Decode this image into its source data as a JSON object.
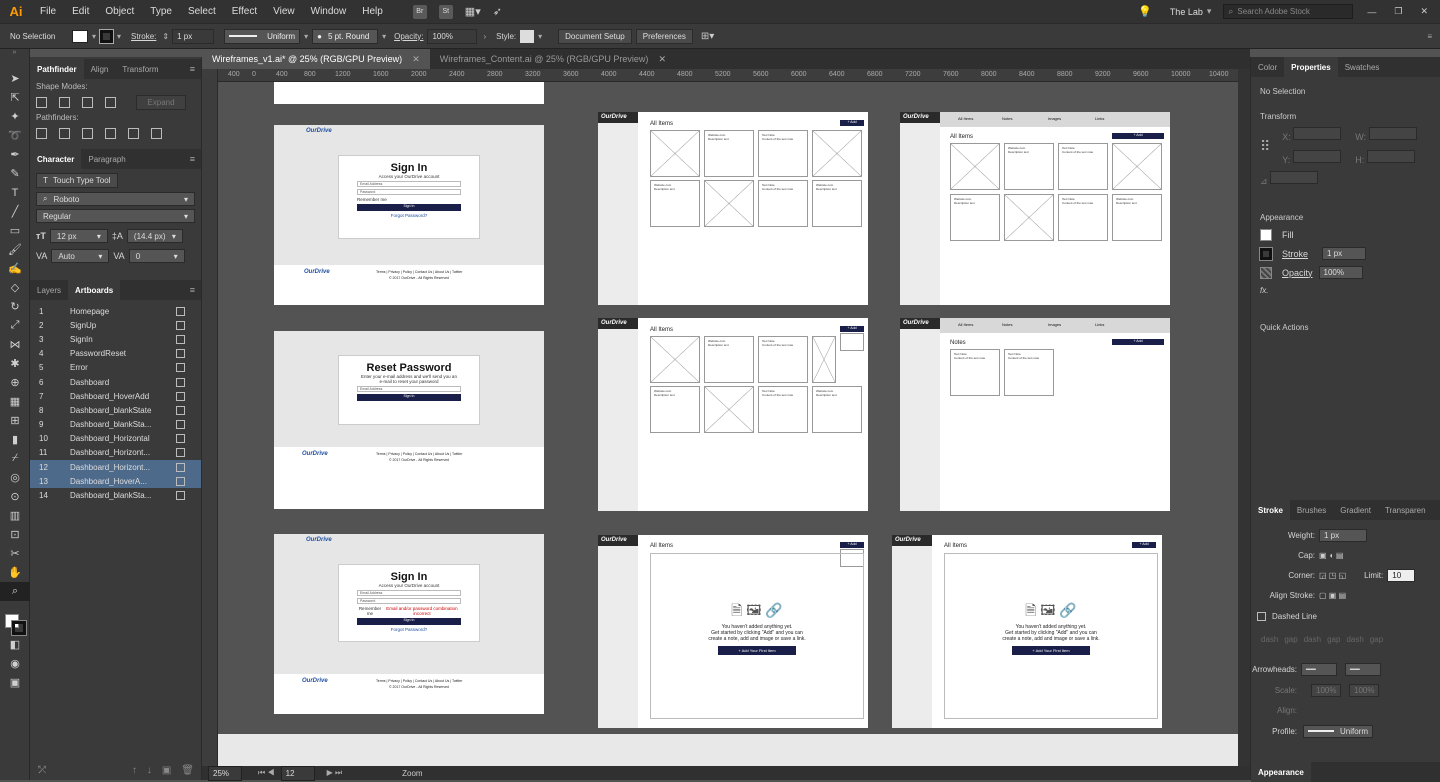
{
  "app": {
    "logo": "Ai"
  },
  "menu": [
    "File",
    "Edit",
    "Object",
    "Type",
    "Select",
    "Effect",
    "View",
    "Window",
    "Help"
  ],
  "bridge": [
    "Br",
    "St"
  ],
  "workspace": "The Lab",
  "search_placeholder": "Search Adobe Stock",
  "control": {
    "selection": "No Selection",
    "stroke_label": "Stroke:",
    "stroke_value": "1 px",
    "profile": "Uniform",
    "brush": "5 pt. Round",
    "opacity_label": "Opacity:",
    "opacity_value": "100%",
    "style_label": "Style:",
    "doc_setup": "Document Setup",
    "preferences": "Preferences"
  },
  "doc_tabs": [
    {
      "label": "Wireframes_v1.ai* @ 25% (RGB/GPU Preview)"
    },
    {
      "label": "Wireframes_Content.ai @ 25% (RGB/GPU Preview)"
    }
  ],
  "ruler": [
    "400",
    "0",
    "400",
    "800",
    "1200",
    "1600",
    "2000",
    "2400",
    "2800",
    "3200",
    "3600",
    "4000",
    "4400",
    "4800",
    "5200",
    "5600",
    "6000",
    "6400",
    "6800",
    "7200",
    "7600",
    "8000",
    "8400",
    "8800",
    "9200",
    "9600",
    "10000",
    "10400"
  ],
  "left_panel": {
    "tabs1": [
      "Pathfinder",
      "Align",
      "Transform"
    ],
    "shape_modes": "Shape Modes:",
    "expand": "Expand",
    "pathfinders": "Pathfinders:",
    "tabs2": [
      "Character",
      "Paragraph"
    ],
    "touch_type": "Touch Type Tool",
    "font": "Roboto",
    "style": "Regular",
    "size": "12 px",
    "leading": "(14.4 px)",
    "kerning": "Auto",
    "tracking": "0",
    "tabs3": [
      "Layers",
      "Artboards"
    ],
    "artboards": [
      {
        "n": "1",
        "name": "Homepage"
      },
      {
        "n": "2",
        "name": "SignUp"
      },
      {
        "n": "3",
        "name": "SignIn"
      },
      {
        "n": "4",
        "name": "PasswordReset"
      },
      {
        "n": "5",
        "name": "Error"
      },
      {
        "n": "6",
        "name": "Dashboard"
      },
      {
        "n": "7",
        "name": "Dashboard_HoverAdd"
      },
      {
        "n": "8",
        "name": "Dashboard_blankState"
      },
      {
        "n": "9",
        "name": "Dashboard_blankSta..."
      },
      {
        "n": "10",
        "name": "Dashboard_Horizontal"
      },
      {
        "n": "11",
        "name": "Dashboard_Horizont..."
      },
      {
        "n": "12",
        "name": "Dashboard_Horizont..."
      },
      {
        "n": "13",
        "name": "Dashboard_HoverA..."
      },
      {
        "n": "14",
        "name": "Dashboard_blankSta..."
      }
    ]
  },
  "right_panel": {
    "tabs": [
      "Color",
      "Properties",
      "Swatches"
    ],
    "no_selection": "No Selection",
    "transform": "Transform",
    "appearance": "Appearance",
    "fill": "Fill",
    "stroke": "Stroke",
    "stroke_val": "1 px",
    "opacity": "Opacity",
    "opacity_val": "100%",
    "fx": "fx.",
    "quick_actions": "Quick Actions",
    "stroke_tabs": [
      "Stroke",
      "Brushes",
      "Gradient",
      "Transparen"
    ],
    "weight_label": "Weight:",
    "weight_val": "1 px",
    "cap_label": "Cap:",
    "corner_label": "Corner:",
    "limit_label": "Limit:",
    "limit_val": "10",
    "align_stroke": "Align Stroke:",
    "dashed_line": "Dashed Line",
    "dash": "dash",
    "gap": "gap",
    "arrowheads": "Arrowheads:",
    "scale": "Scale:",
    "scale_val": "100%",
    "align": "Align:",
    "profile": "Profile:",
    "profile_val": "Uniform",
    "bottom": "Appearance"
  },
  "status": {
    "zoom": "25%",
    "page": "12",
    "label": "Zoom"
  },
  "wire": {
    "brand": "OurDrive",
    "signin_title": "Sign In",
    "signin_sub": "Access your OurDrive account",
    "email": "Email Address",
    "password": "Password",
    "remember": "Remember me",
    "signin_btn": "Sign In",
    "forgot": "Forgot Password?",
    "reset_title": "Reset Password",
    "reset_sub": "Enter your e-mail address and we'll send you an e-mail to reset your password",
    "footer": "Terms | Privacy | Policy | Contact Us | About Us | Twitter",
    "copyright": "© 2017 OurDrive - All Rights Reserved",
    "all_items": "All Items",
    "notes": "Notes",
    "add": "+ Add",
    "tabs": [
      "All Items",
      "Notes",
      "Images",
      "Links"
    ],
    "empty1": "You haven't added anything yet.",
    "empty2": "Get started by clicking \"Add\" and you can",
    "empty3": "create a note, add and image or save a link.",
    "empty_cta": "+ Add Your First Item",
    "error_note": "Email and/or password combination incorrect"
  }
}
